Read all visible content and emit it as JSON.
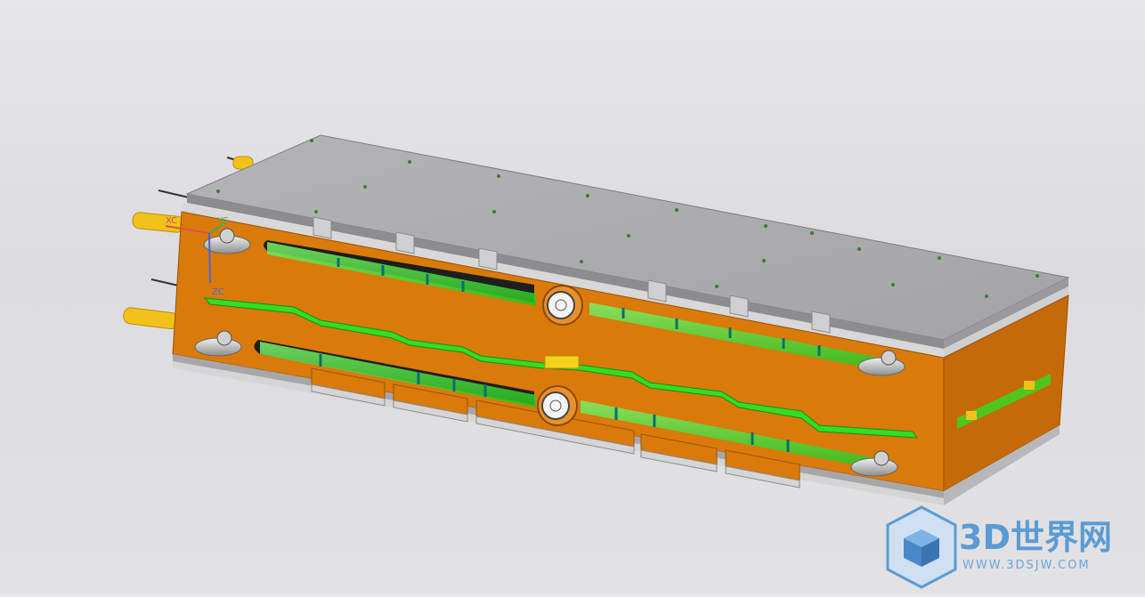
{
  "axes": {
    "x_label": "XC",
    "y_label": "YC",
    "z_label": "ZC",
    "x_color": "#d9534f",
    "y_color": "#3fae49",
    "z_color": "#4a63d9"
  },
  "watermark": {
    "title": "3D世界网",
    "subtitle": "WWW.3DSJW.COM",
    "icon": "cube-logo-icon",
    "color": "#5b9bd5"
  },
  "colors": {
    "plate": "#a9a9ab",
    "plate_top": "#bdbdbf",
    "mold_body": "#d97a0a",
    "mold_side": "#c46a08",
    "channel": "#33dd22",
    "pin": "#f2c21a"
  }
}
